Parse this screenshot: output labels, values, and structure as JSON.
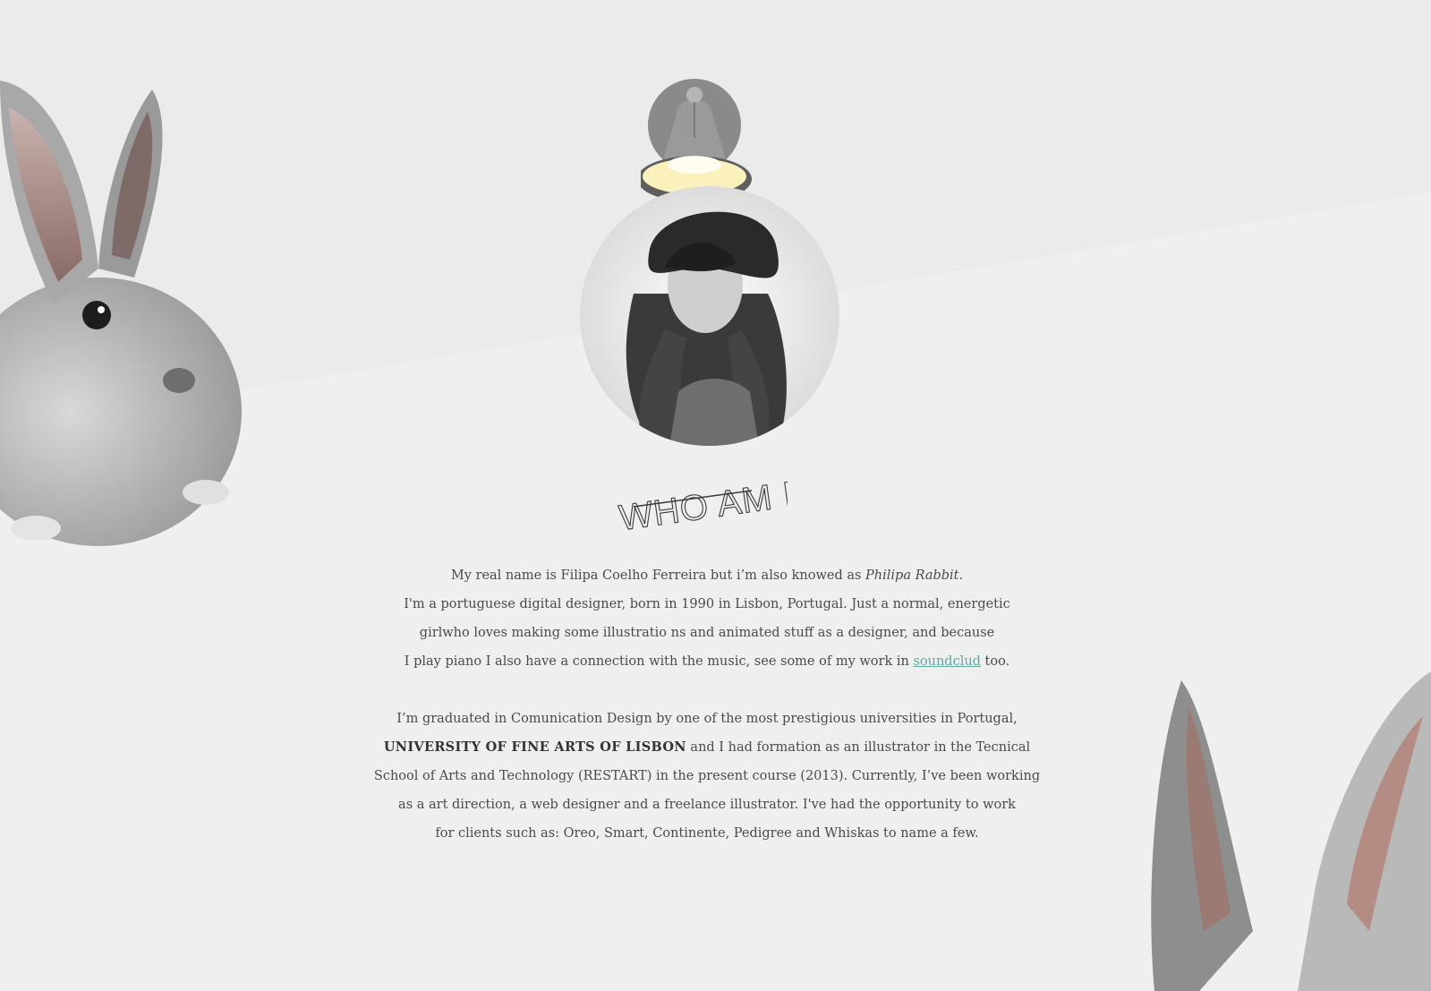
{
  "heading": {
    "text": "WHO AM I ?"
  },
  "bio": {
    "line1_before": "My real name is Filipa Coelho Ferreira but i’m also knowed as ",
    "line1_italic": "Philipa Rabbit",
    "line1_after": ".",
    "line2": "I'm a portuguese digital designer, born in 1990 in Lisbon, Portugal. Just a normal, energetic",
    "line3": "girlwho loves making some illustratio ns and animated stuff as a designer, and because",
    "line4_before": "I play piano I also have a connection with the music, see some of my work in ",
    "line4_link": "soundclud",
    "line4_after": " too.",
    "line5": "I’m graduated in Comunication Design by one of the most prestigious universities in Portugal,",
    "line6_bold": "UNIVERSITY OF FINE ARTS OF LISBON",
    "line6_after": " and I had formation as an illustrator in the Tecnical",
    "line7": "School of Arts and Technology (RESTART) in the present course (2013). Currently, I’ve been working",
    "line8": "as a art direction, a web designer and a freelance illustrator. I've had the opportunity to work",
    "line9": "for clients such as: Oreo, Smart, Continente, Pedigree and Whiskas to name a few."
  },
  "colors": {
    "background": "#efefef",
    "text": "#4a4a4a",
    "link": "#5eaa9e",
    "lamp_light": "#fbf1bd"
  },
  "icons": [
    "lamp-icon",
    "rabbit-illustration",
    "portrait-photo"
  ]
}
